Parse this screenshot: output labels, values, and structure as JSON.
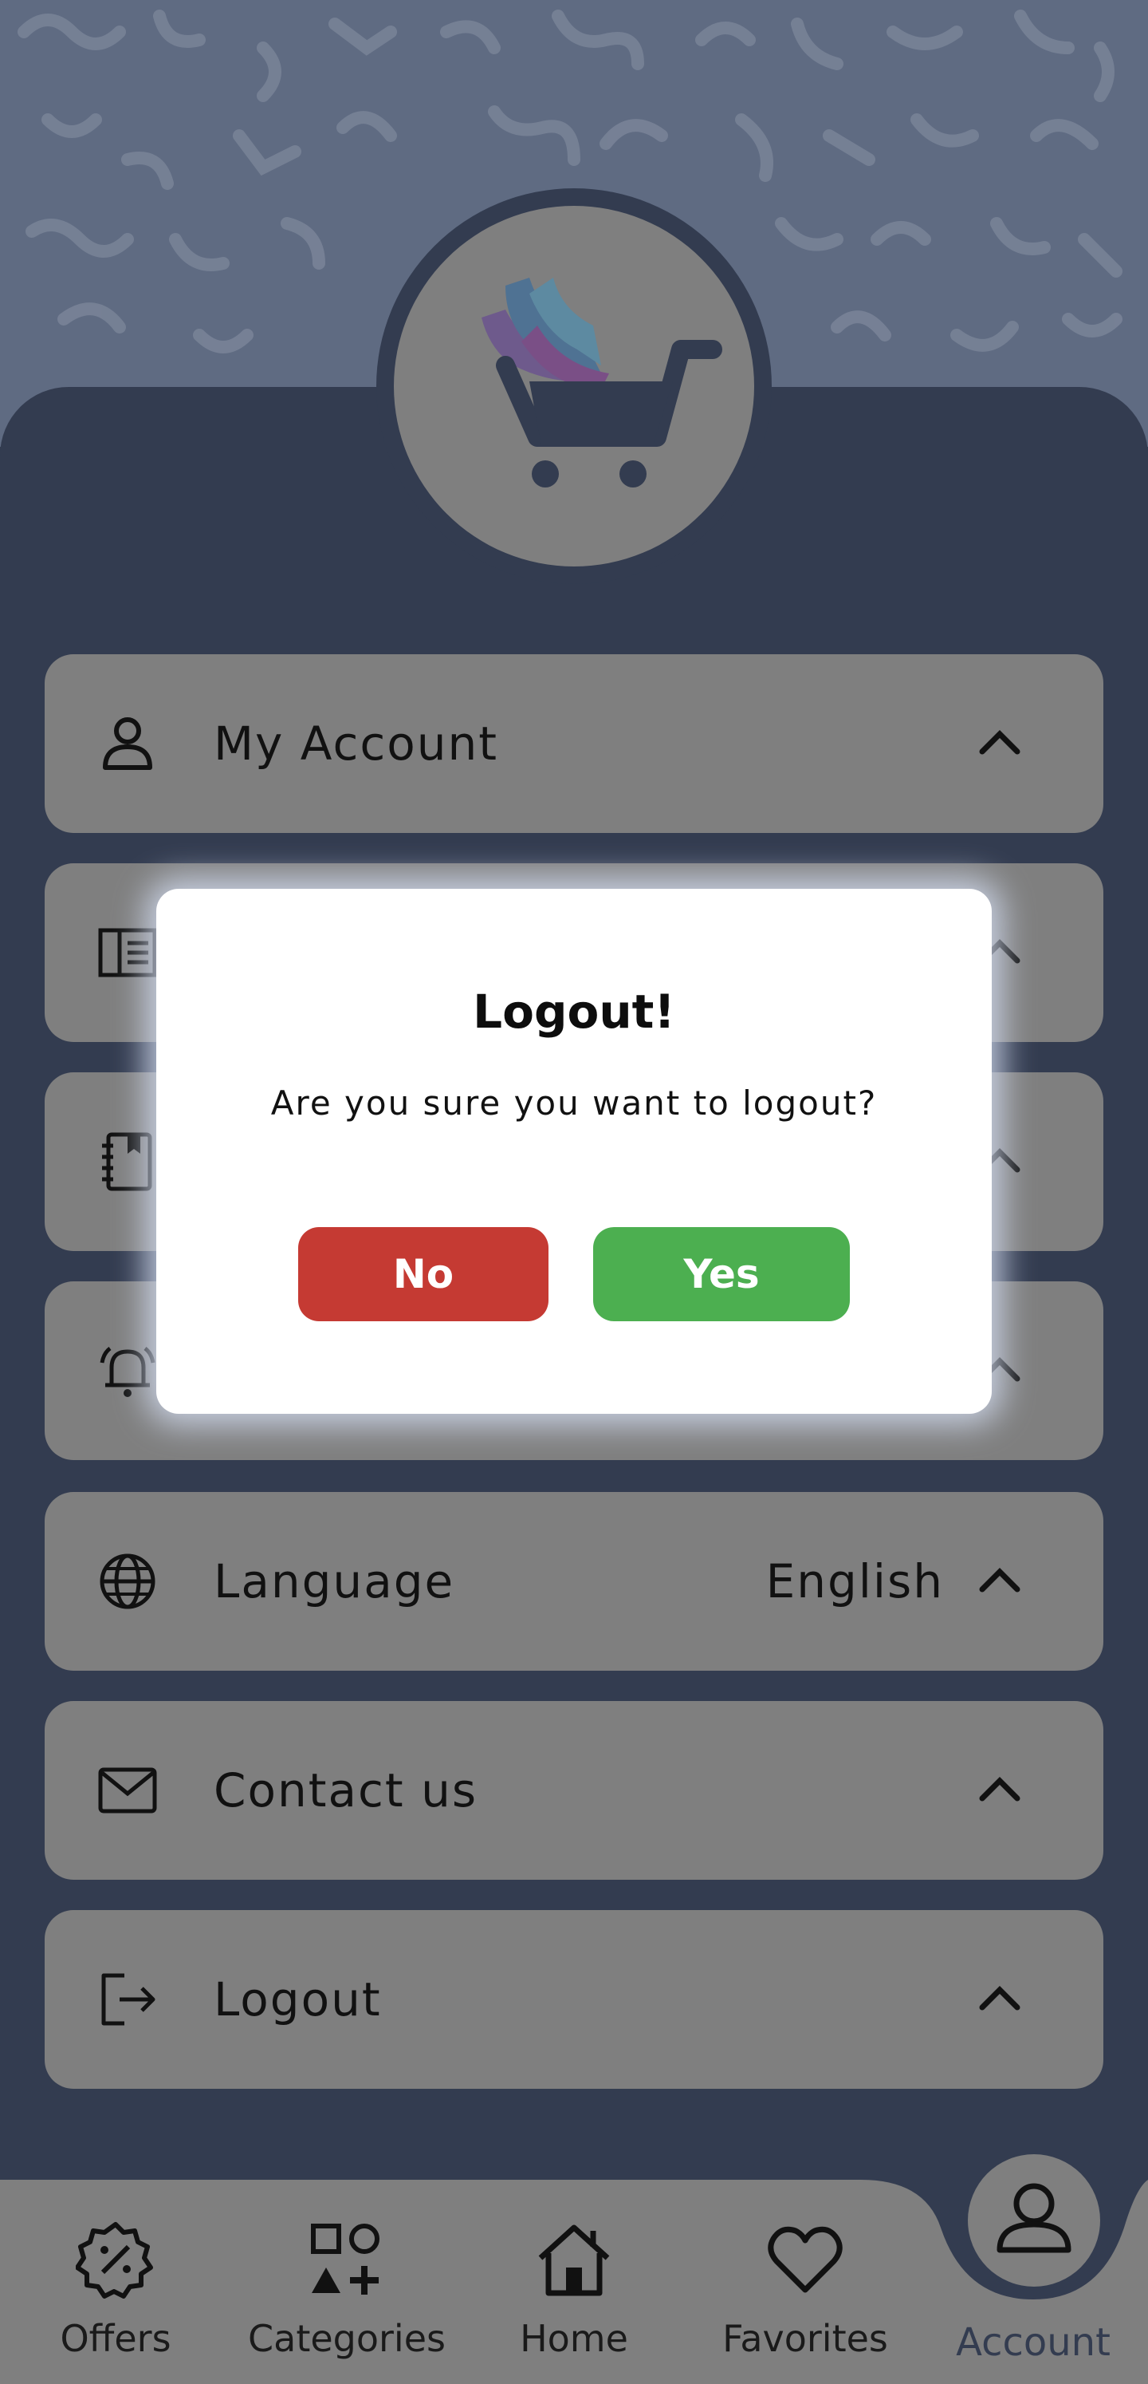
{
  "menu": {
    "items": [
      {
        "label": "My Account",
        "value": "",
        "icon": "person-icon"
      },
      {
        "label": "",
        "value": "",
        "icon": "id-card-icon"
      },
      {
        "label": "",
        "value": "",
        "icon": "address-book-icon"
      },
      {
        "label": "",
        "value": "",
        "icon": "bell-icon"
      },
      {
        "label": "Language",
        "value": "English",
        "icon": "globe-icon"
      },
      {
        "label": "Contact us",
        "value": "",
        "icon": "mail-icon"
      },
      {
        "label": "Logout",
        "value": "",
        "icon": "logout-icon"
      }
    ]
  },
  "dialog": {
    "title": "Logout!",
    "message": "Are you sure you want to logout?",
    "no_label": "No",
    "yes_label": "Yes"
  },
  "nav": {
    "items": [
      {
        "label": "Offers",
        "icon": "discount-badge-icon"
      },
      {
        "label": "Categories",
        "icon": "shapes-icon"
      },
      {
        "label": "Home",
        "icon": "home-icon"
      },
      {
        "label": "Favorites",
        "icon": "heart-icon"
      },
      {
        "label": "Account",
        "icon": "person-icon",
        "active": true
      }
    ]
  },
  "colors": {
    "panel": "#333c50",
    "overlay_gray": "#7f7f7f",
    "no_button": "#c53a33",
    "yes_button": "#4caf50",
    "active_tab": "#333c50"
  }
}
